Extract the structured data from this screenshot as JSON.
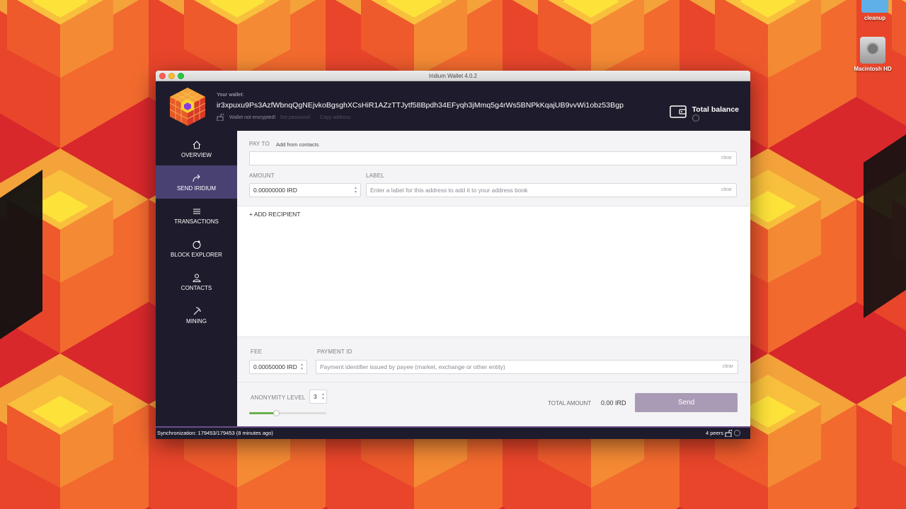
{
  "desktop": {
    "icons": [
      {
        "label": "cleanup"
      },
      {
        "label": "Macintosh HD"
      }
    ]
  },
  "window": {
    "title": "Iridium Wallet 4.0.2"
  },
  "header": {
    "wallet_label": "Your wallet:",
    "wallet_address": "ir3xpuxu9Ps3AzfWbnqQgNEjvkoBgsghXCsHiR1AZzTTJytf58Bpdh34EFyqh3jMmq5g4rWs5BNPkKqajUB9vvWi1obz53Bgp",
    "encryption_status": "Wallet not encrypted!",
    "set_password": "Set password",
    "copy_address": "Copy address",
    "total_balance_label": "Total balance"
  },
  "sidebar": {
    "items": [
      {
        "label": "OVERVIEW",
        "icon": "home-icon",
        "active": false
      },
      {
        "label": "SEND IRIDIUM",
        "icon": "send-icon",
        "active": true
      },
      {
        "label": "TRANSACTIONS",
        "icon": "list-icon",
        "active": false
      },
      {
        "label": "BLOCK EXPLORER",
        "icon": "explorer-icon",
        "active": false
      },
      {
        "label": "CONTACTS",
        "icon": "person-icon",
        "active": false
      },
      {
        "label": "MINING",
        "icon": "pickaxe-icon",
        "active": false
      }
    ]
  },
  "send": {
    "pay_to_label": "PAY TO",
    "add_from_contacts": "Add from contacts",
    "pay_to_value": "",
    "clear": "clear",
    "amount_label": "AMOUNT",
    "amount_value": "0.00000000 IRD",
    "label_label": "LABEL",
    "label_placeholder": "Enter a label for this address to add it to your address book",
    "add_recipient": "+ ADD RECIPIENT",
    "fee_label": "FEE",
    "fee_value": "0.00050000 IRD",
    "payment_id_label": "PAYMENT ID",
    "payment_id_placeholder": "Payment identifier issued by payee (market, exchange or other entity)",
    "anonymity_label": "ANONYMITY LEVEL",
    "anonymity_value": "3",
    "anonymity_slider_fraction": 0.35,
    "total_amount_label": "TOTAL AMOUNT",
    "total_amount_value": "0.00 IRD",
    "send_button": "Send"
  },
  "status": {
    "sync": "Synchronization: 179453/179453 (8 minutes ago)",
    "peers": "4 peers"
  },
  "colors": {
    "dark_bg": "#1e1c2c",
    "active_nav": "#4a4173",
    "send_button": "#a99bb5",
    "slider_fill": "#6ab04c"
  }
}
